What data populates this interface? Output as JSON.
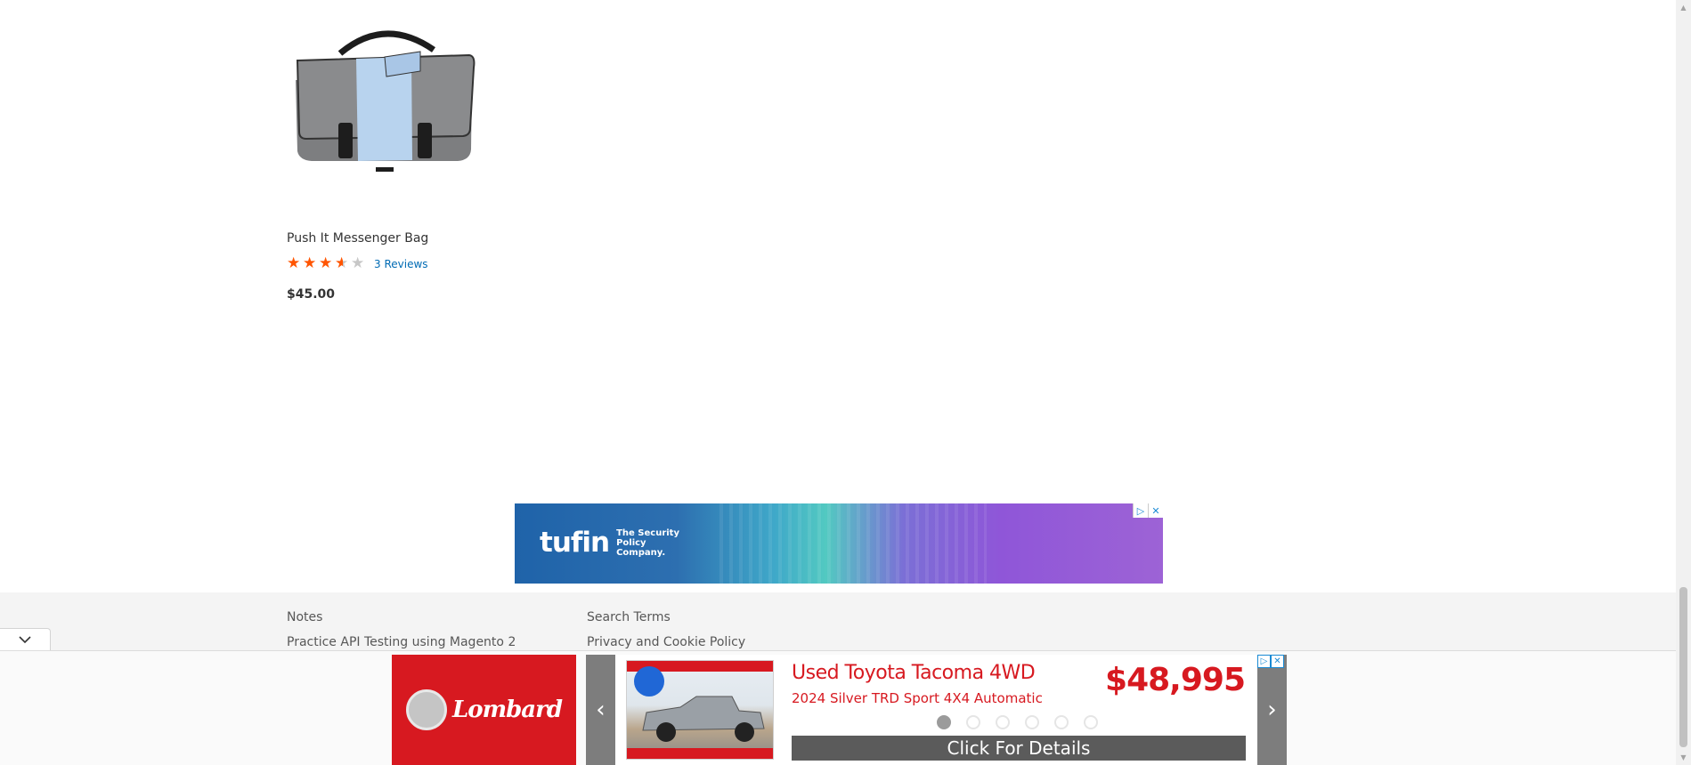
{
  "product": {
    "name": "Push It Messenger Bag",
    "rating_percent": 65,
    "reviews_label": "3 Reviews",
    "price": "$45.00"
  },
  "banner_ad": {
    "brand": "tufin",
    "tagline": "The Security Policy Company."
  },
  "footer": {
    "links": [
      "Notes",
      "Practice API Testing using Magento 2",
      "Search Terms",
      "Privacy and Cookie Policy"
    ]
  },
  "sticky_ad": {
    "dealer": "Lombard",
    "title": "Used Toyota Tacoma 4WD",
    "subtitle": "2024 Silver TRD Sport 4X4 Automatic",
    "price": "$48,995",
    "cta": "Click For Details",
    "slide_count": 6,
    "active_slide": 1
  },
  "icons": {
    "collapse": "chevron-down-icon",
    "prev": "chevron-left-icon",
    "next": "chevron-right-icon",
    "adchoices": "adchoices-icon",
    "close": "close-icon"
  },
  "colors": {
    "star_fill": "#ff5501",
    "link": "#006bb4",
    "ad_red": "#d71920",
    "footer_bg": "#f4f4f4"
  }
}
